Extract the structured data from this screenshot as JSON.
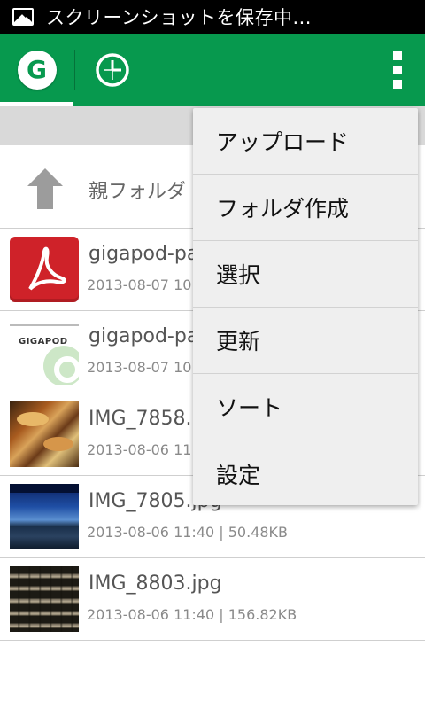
{
  "status_bar": {
    "icon": "screenshot-image-icon",
    "message": "スクリーンショットを保存中..."
  },
  "action_bar": {
    "logo_letter": "G",
    "tabs": [
      {
        "name": "home",
        "icon": "g-logo-icon",
        "selected": true
      },
      {
        "name": "history",
        "icon": "clock-icon",
        "selected": false
      }
    ],
    "overflow_icon": "overflow-menu-icon",
    "colors": {
      "brand_green": "#07994e"
    }
  },
  "files": {
    "parent": {
      "label": "親フォルダ",
      "icon": "up-arrow-icon"
    },
    "items": [
      {
        "name": "gigapod-pa",
        "meta": "2013-08-07 10",
        "thumb": "pdf"
      },
      {
        "name": "gigapod-pa",
        "meta": "2013-08-07 10",
        "thumb": "gigapod-logo"
      },
      {
        "name": "IMG_7858.",
        "meta": "2013-08-06 11",
        "thumb": "photo-food"
      },
      {
        "name": "IMG_7805.jpg",
        "meta": "2013-08-06 11:40 | 50.48KB",
        "thumb": "photo-sky"
      },
      {
        "name": "IMG_8803.jpg",
        "meta": "2013-08-06 11:40 | 156.82KB",
        "thumb": "photo-rails"
      }
    ]
  },
  "gigapod_thumb_text": "GIGAPOD",
  "menu": {
    "items": [
      "アップロード",
      "フォルダ作成",
      "選択",
      "更新",
      "ソート",
      "設定"
    ]
  }
}
